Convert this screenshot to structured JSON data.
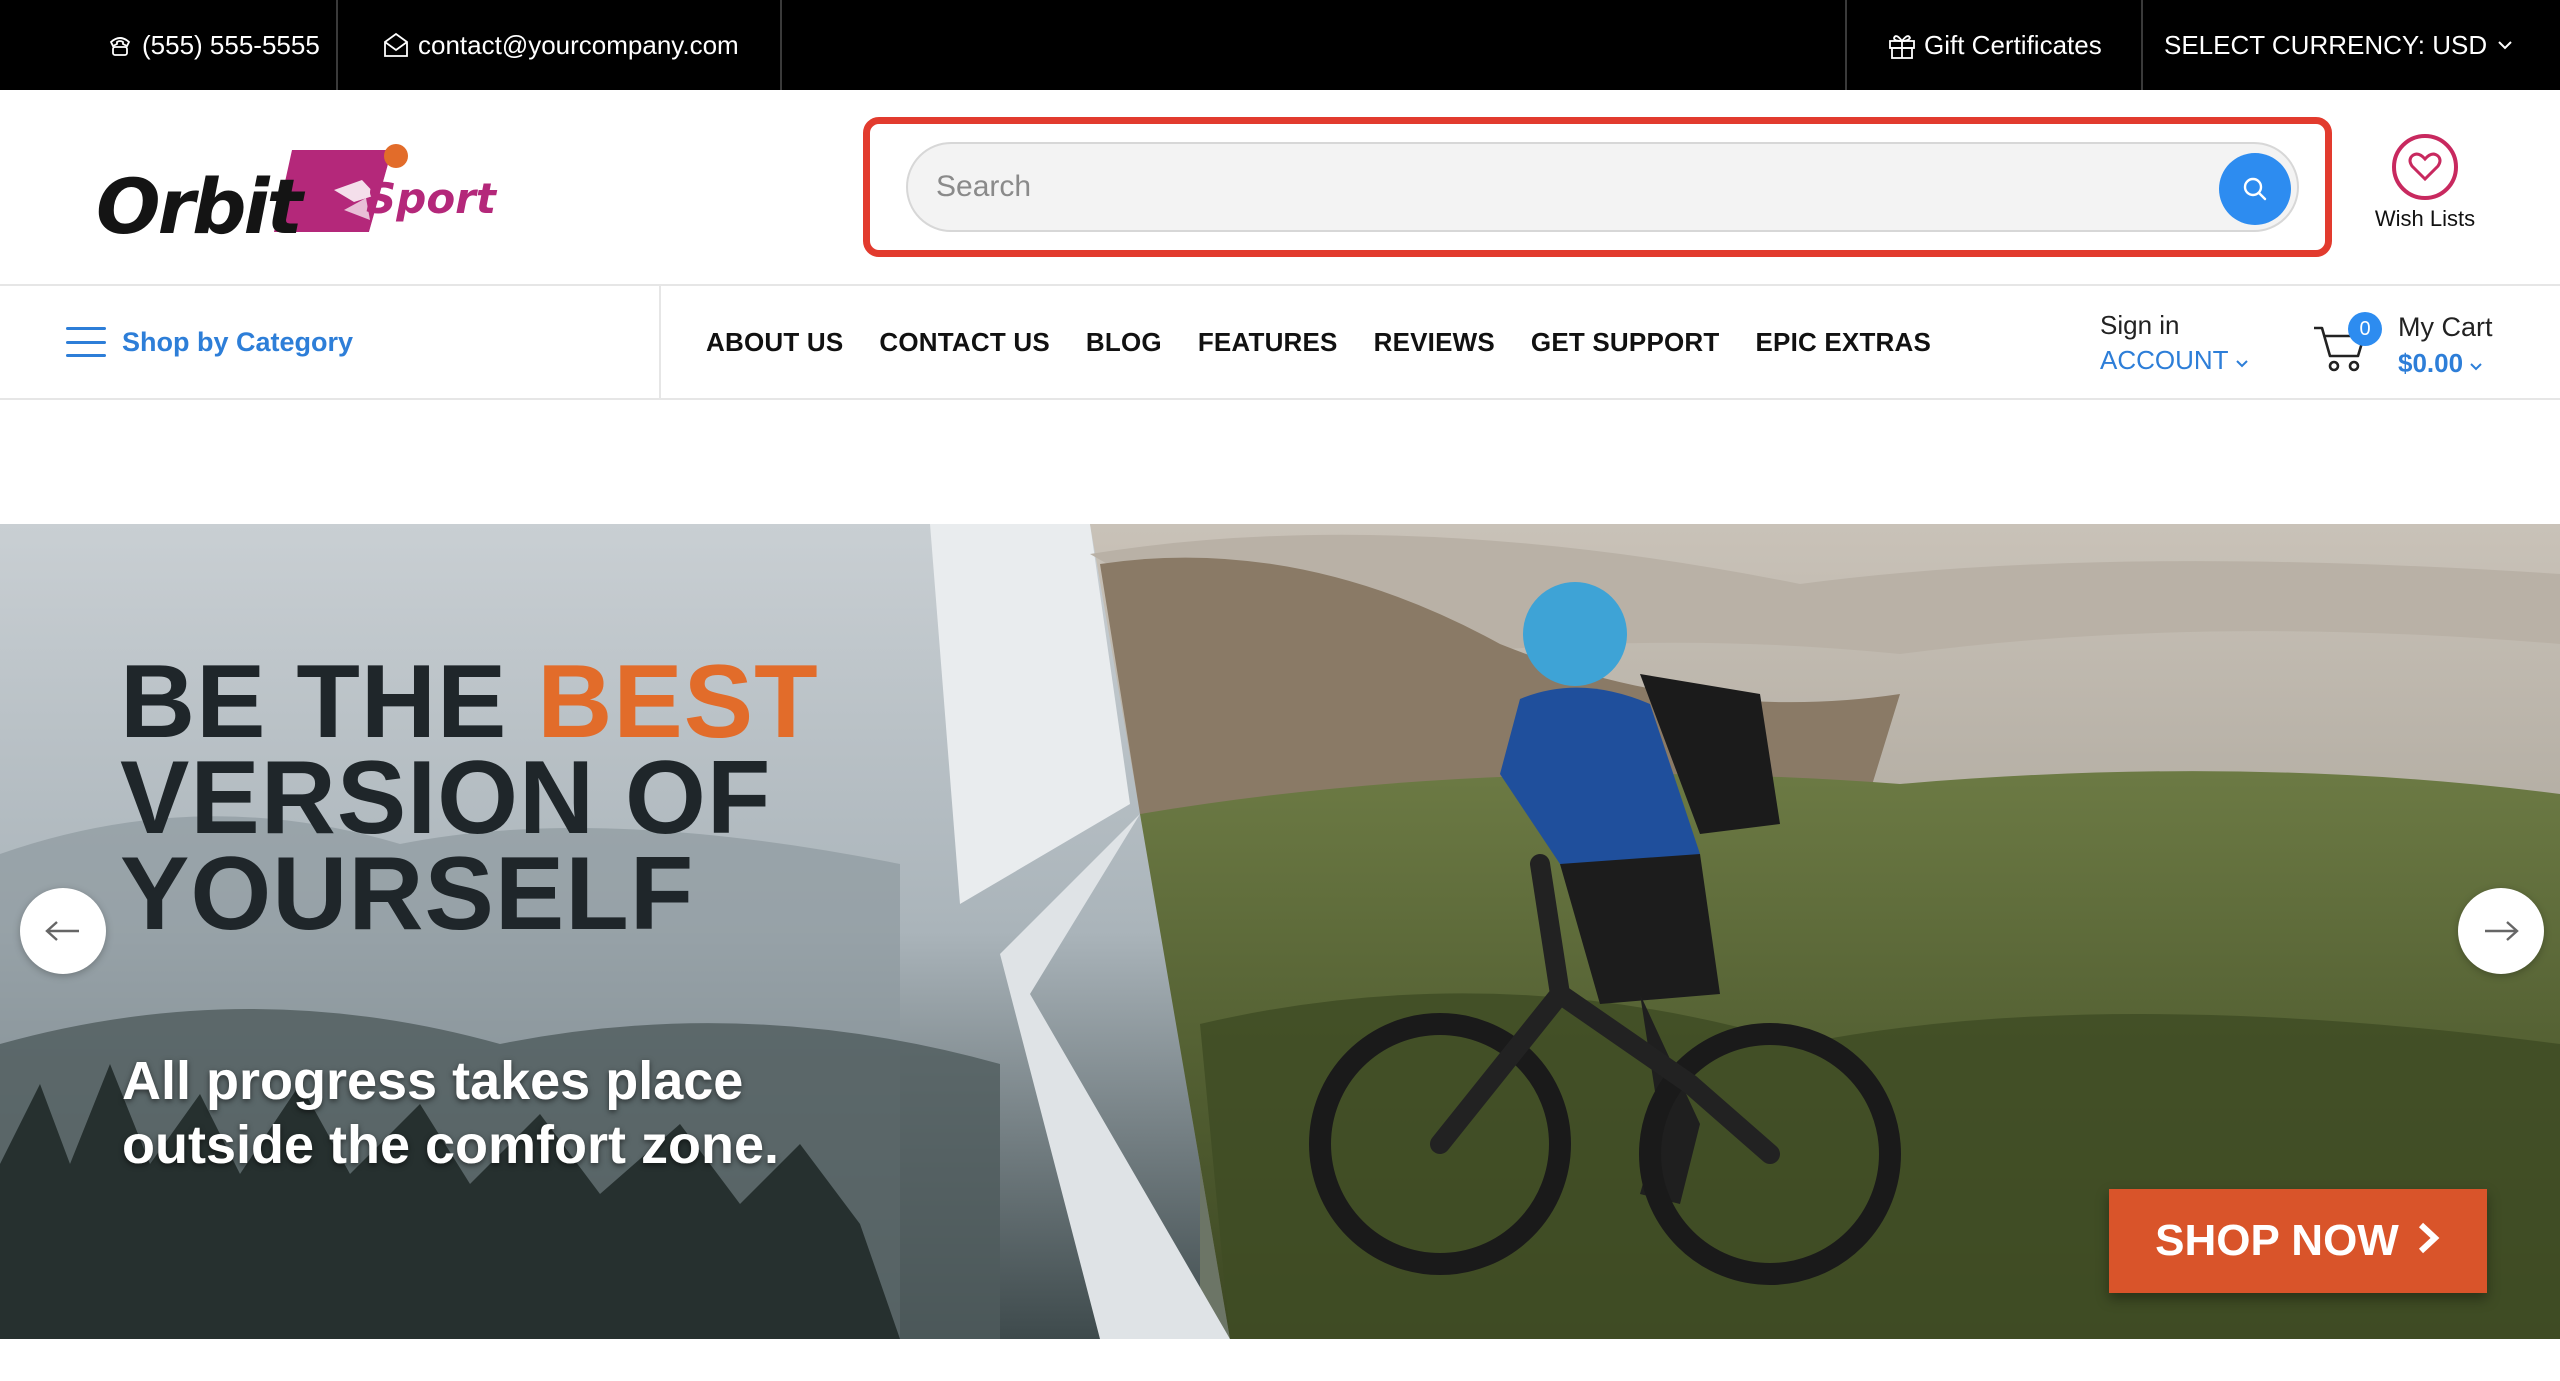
{
  "topbar": {
    "phone": "(555) 555-5555",
    "email": "contact@yourcompany.com",
    "gift": "Gift Certificates",
    "currency": "SELECT CURRENCY: USD"
  },
  "logo": {
    "word1": "Orbit",
    "word2": "Sport"
  },
  "search": {
    "placeholder": "Search"
  },
  "wishlist": {
    "label": "Wish Lists"
  },
  "nav": {
    "category": "Shop by Category",
    "items": [
      "ABOUT US",
      "CONTACT US",
      "BLOG",
      "FEATURES",
      "REVIEWS",
      "GET SUPPORT",
      "EPIC EXTRAS"
    ],
    "signin": "Sign in",
    "account": "ACCOUNT",
    "cart_label": "My Cart",
    "cart_total": "$0.00",
    "cart_count": "0"
  },
  "hero": {
    "headline_1": "BE THE ",
    "headline_accent": "BEST",
    "headline_2": "VERSION OF",
    "headline_3": "YOURSELF",
    "sub_1": "All progress takes place",
    "sub_2": "outside the comfort zone.",
    "cta": "SHOP NOW"
  },
  "colors": {
    "accent_blue": "#2d7ed8",
    "highlight_red": "#e23b2e",
    "cta_orange": "#d9542a",
    "wishlist_pink": "#c8295f"
  }
}
